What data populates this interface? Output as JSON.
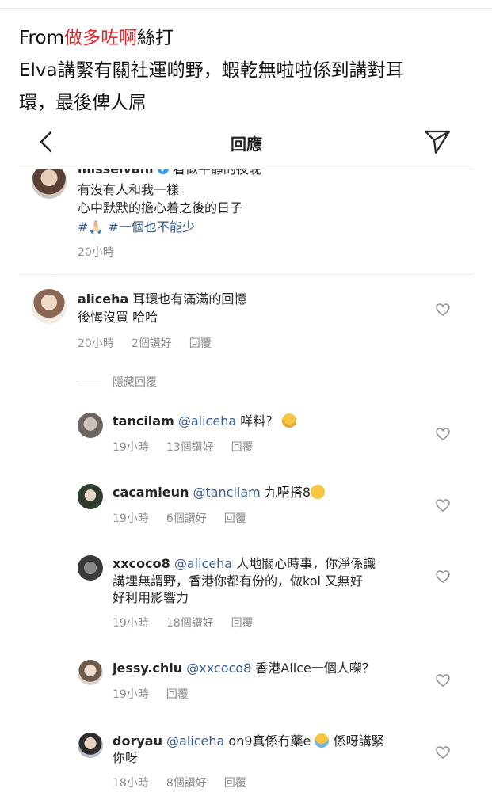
{
  "post": {
    "line1_prefix": "From",
    "line1_highlight": "做多咗啊",
    "line1_suffix": "絲打",
    "line2": "Elva講緊有關社運啲野，蝦乾無啦啦係到講對耳",
    "line3": "環，最後俾人屌"
  },
  "header": {
    "title": "回應"
  },
  "caption": {
    "username": "misselvani",
    "top_text": "看似平靜的夜晚",
    "lines": [
      "有沒有人和我一樣",
      "心中默默的擔心着之後的日子"
    ],
    "hashtag1": "#🙏🏻",
    "hashtag2": "#一個也不能少",
    "time": "20小時"
  },
  "comments": [
    {
      "username": "aliceha",
      "text_line1": "耳環也有滿滿的回憶",
      "text_line2": "後悔沒買 哈哈",
      "time": "20小時",
      "likes": "2個讚好",
      "reply": "回覆"
    }
  ],
  "hidden_replies_label": "隱藏回覆",
  "replies": [
    {
      "username": "tancilam",
      "mention": "@aliceha",
      "text": "咩料？",
      "emoji": "downcast-sweat-face",
      "time": "19小時",
      "likes": "13個讚好",
      "reply": "回覆"
    },
    {
      "username": "cacamieun",
      "mention": "@tancilam",
      "text": "九唔搭8",
      "emoji": "eye-roll-face",
      "time": "19小時",
      "likes": "6個讚好",
      "reply": "回覆"
    },
    {
      "username": "xxcoco8",
      "mention": "@aliceha",
      "text_line1": "人地關心時事，你淨係識",
      "text_line2": "講埋無謂野，香港你都有份的，做kol 又無好",
      "text_line3": "好利用影響力",
      "time": "19小時",
      "likes": "18個讚好",
      "reply": "回覆"
    },
    {
      "username": "jessy.chiu",
      "mention": "@xxcoco8",
      "text": "香港Alice一個人㗎？",
      "time": "19小時",
      "reply": "回覆"
    },
    {
      "username": "doryau",
      "mention": "@aliceha",
      "text_line1": "on9真係冇藥e",
      "emoji": "tears-of-joy-face",
      "text_line1b": "係呀講緊",
      "text_line2": "你呀",
      "time": "18小時",
      "likes": "8個讚好",
      "reply": "回覆"
    }
  ],
  "colors": {
    "highlight": "#e0262b",
    "mention": "#3b5e94",
    "meta": "#8e8e8e",
    "verified": "#3897f0"
  }
}
